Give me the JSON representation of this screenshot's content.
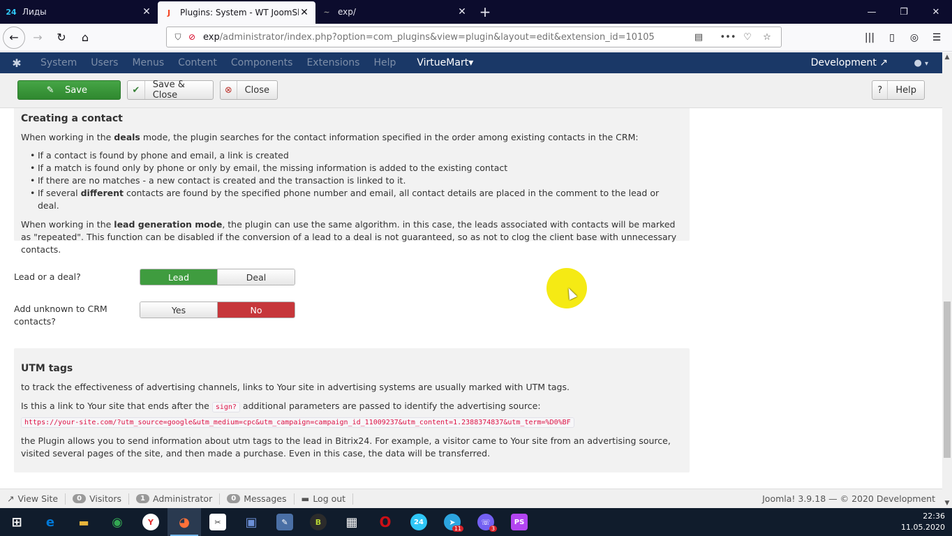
{
  "browser": {
    "tabs": [
      {
        "label": "Лиды",
        "fav": "24",
        "favcolor": "#2fc6f6",
        "active": false
      },
      {
        "label": "Plugins: System - WT JoomShopping",
        "fav": "J",
        "favcolor": "#f44321",
        "active": true
      },
      {
        "label": "exp/",
        "fav": "~",
        "favcolor": "#888888",
        "active": false
      }
    ],
    "new_tab_icon": "plus-icon",
    "url_host": "exp",
    "url_path": "/administrator/index.php?option=com_plugins&view=plugin&layout=edit&extension_id=10105"
  },
  "joomla_nav": {
    "items": [
      "System",
      "Users",
      "Menus",
      "Content",
      "Components",
      "Extensions",
      "Help"
    ],
    "virtuemart": "VirtueMart",
    "site_name": "Development"
  },
  "toolbar": {
    "save_label": "Save",
    "save_close_label": "Save & Close",
    "close_label": "Close",
    "help_label": "Help"
  },
  "section1": {
    "title": "Creating a contact",
    "intro_a": "When working in the ",
    "intro_b": "deals",
    "intro_c": " mode, the plugin searches for the contact information specified in the order among existing contacts in the CRM:",
    "bullets": [
      "If a contact is found by phone and email, a link is created",
      "If a match is found only by phone or only by email, the missing information is added to the existing contact",
      "If there are no matches - a new contact is created and the transaction is linked to it."
    ],
    "bullet4_a": "If several ",
    "bullet4_b": "different",
    "bullet4_c": " contacts are found by the specified phone number and email, all contact details are placed in the comment to the lead or deal.",
    "para_a": "When working in the ",
    "para_b": "lead generation mode",
    "para_c": ", the plugin can use the same algorithm. in this case, the leads associated with contacts will be marked as \"repeated\". This function can be disabled if the conversion of a lead to a deal is not guaranteed, so as not to clog the client base with unnecessary contacts."
  },
  "fields": {
    "lead_or_deal_label": "Lead or a deal?",
    "lead_option": "Lead",
    "deal_option": "Deal",
    "add_unknown_label": "Add unknown to CRM contacts?",
    "yes_option": "Yes",
    "no_option": "No"
  },
  "section2": {
    "title": "UTM tags",
    "p1": "to track the effectiveness of advertising channels, links to Your site in advertising systems are usually marked with UTM tags.",
    "p2_a": "Is this a link to Your site that ends after the ",
    "p2_code": "sign?",
    "p2_c": " additional parameters are passed to identify the advertising source:",
    "example_url": "https://your-site.com/?utm_source=google&utm_medium=cpc&utm_campaign=campaign_id_11009237&utm_content=1.2388374837&utm_term=%D0%BF",
    "p3": "the Plugin allows you to send information about utm tags to the lead in Bitrix24. For example, a visitor came to Your site from an advertising source, visited several pages of the site, and then made a purchase. Even in this case, the data will be transferred."
  },
  "statusbar": {
    "view_site": "View Site",
    "visitors_count": "0",
    "visitors": "Visitors",
    "admin_count": "1",
    "administrator": "Administrator",
    "messages_count": "0",
    "messages": "Messages",
    "logout": "Log out",
    "version": "Joomla! 3.9.18 — © 2020 Development"
  },
  "taskbar": {
    "apps": [
      {
        "name": "edge",
        "glyph": "e",
        "color": "#0078d7"
      },
      {
        "name": "explorer",
        "glyph": "▬",
        "color": "#e8b53b"
      },
      {
        "name": "chrome",
        "glyph": "◉",
        "color": "#34a853"
      },
      {
        "name": "yandex",
        "glyph": "Y",
        "color": "#e32d2d"
      },
      {
        "name": "firefox",
        "glyph": "◕",
        "color": "#ff7139"
      },
      {
        "name": "snip",
        "glyph": "✂",
        "color": "#3a3a3a"
      },
      {
        "name": "save",
        "glyph": "▣",
        "color": "#2e5aa8"
      },
      {
        "name": "editor",
        "glyph": "✎",
        "color": "#4a6fa5"
      },
      {
        "name": "b-app",
        "glyph": "B",
        "color": "#6a8f1d"
      },
      {
        "name": "calculator",
        "glyph": "▦",
        "color": "#444444"
      },
      {
        "name": "opera",
        "glyph": "O",
        "color": "#cc0f16"
      },
      {
        "name": "bitrix24",
        "glyph": "24",
        "color": "#2fc6f6"
      },
      {
        "name": "telegram",
        "glyph": "➤",
        "color": "#2ca5e0"
      },
      {
        "name": "viber",
        "glyph": "☏",
        "color": "#7360f2"
      },
      {
        "name": "phpstorm",
        "glyph": "PS",
        "color": "#b345f1"
      }
    ],
    "telegram_badge": "11",
    "viber_badge": "3",
    "time": "22:36",
    "date": "11.05.2020"
  }
}
